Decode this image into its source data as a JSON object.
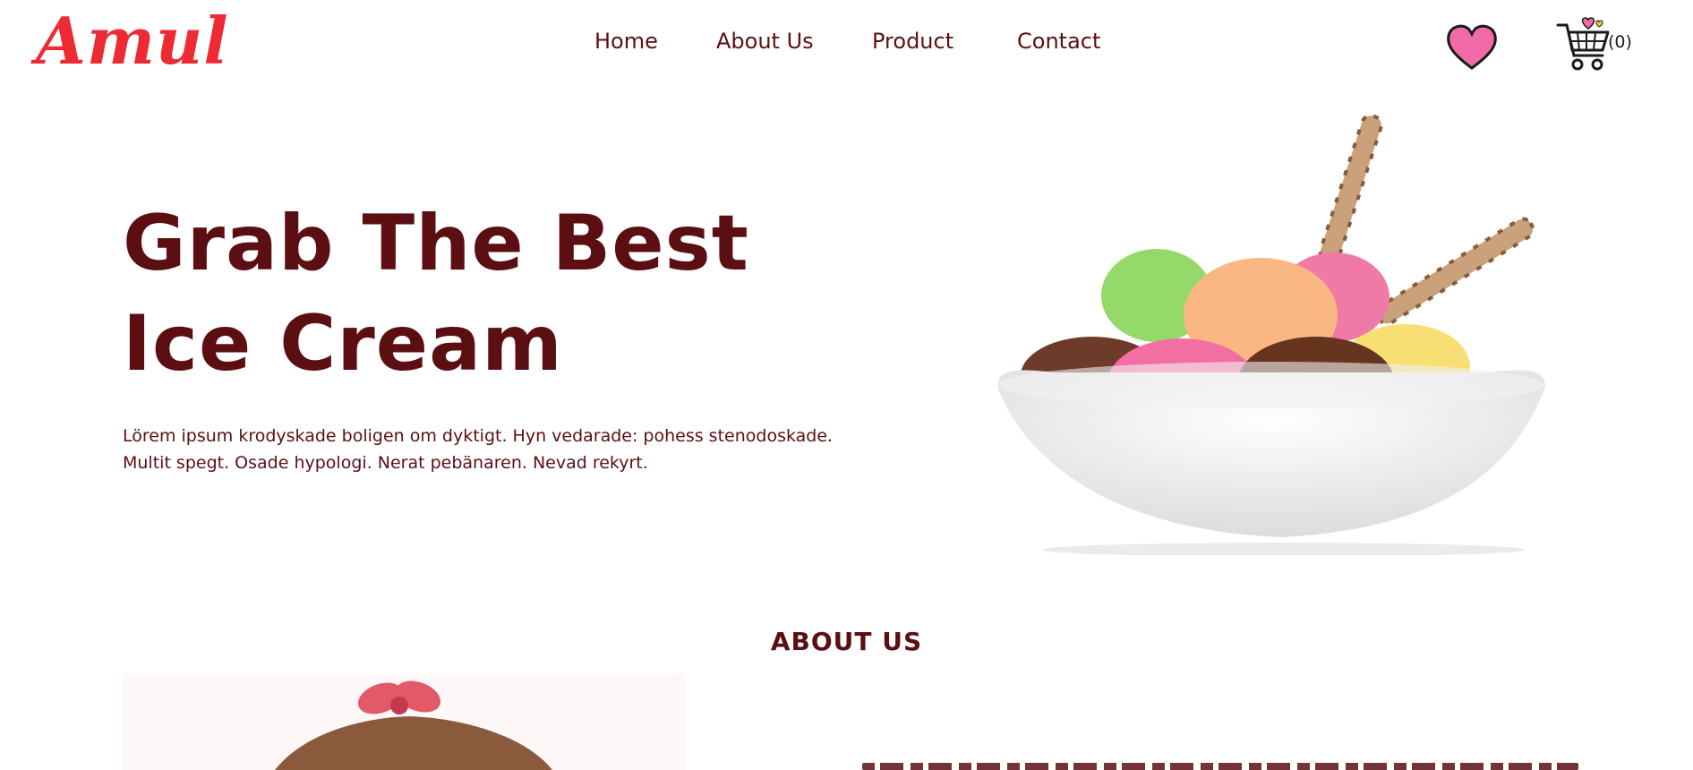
{
  "brand": {
    "logo_text": "Amul",
    "color": "#ee2a33"
  },
  "nav": {
    "items": [
      {
        "label": "Home"
      },
      {
        "label": "About Us"
      },
      {
        "label": "Product"
      },
      {
        "label": "Contact"
      }
    ]
  },
  "header_icons": {
    "wishlist_icon": "heart-icon",
    "cart_icon": "shopping-cart-icon",
    "cart_count": "(0)"
  },
  "hero": {
    "title_line1": "Grab The Best",
    "title_line2": "Ice Cream",
    "text_line1": "Lörem ipsum krodyskade boligen om dyktigt. Hyn vedarade: pohess stenodoskade.",
    "text_line2": "Multit spegt. Osade hypologi. Nerat pebänaren. Nevad rekyrt."
  },
  "about": {
    "heading": "ABOUT US"
  },
  "colors": {
    "text_primary": "#5c0f13",
    "heart_pink": "#f26aa8",
    "background": "#ffffff"
  }
}
